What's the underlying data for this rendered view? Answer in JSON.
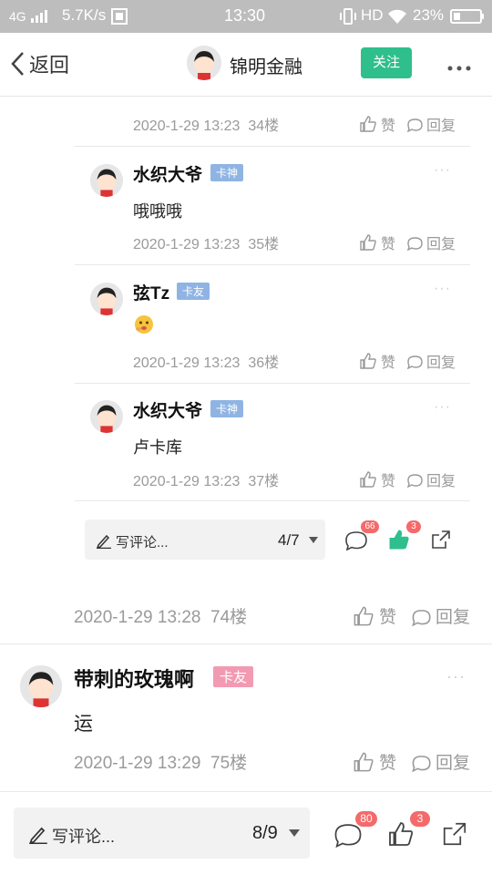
{
  "status_bar": {
    "network": "4G",
    "speed": "5.7K/s",
    "time": "13:30",
    "hd": "HD",
    "battery": "23%"
  },
  "nav": {
    "back_label": "返回",
    "title": "锦明金融",
    "follow_label": "关注",
    "more_icon": "more-icon"
  },
  "thread": {
    "top_meta": {
      "time": "2020-1-29 13:23",
      "floor": "34楼"
    },
    "replies": [
      {
        "name": "水织大爷",
        "badge": "卡神",
        "text": "哦哦哦",
        "time": "2020-1-29 13:23",
        "floor": "35楼"
      },
      {
        "name": "弦Tz",
        "badge": "卡友",
        "text": "",
        "time": "2020-1-29 13:23",
        "floor": "36楼"
      },
      {
        "name": "水织大爷",
        "badge": "卡神",
        "text": "卢卡库",
        "time": "2020-1-29 13:23",
        "floor": "37楼"
      }
    ],
    "like_label": "赞",
    "reply_label": "回复",
    "inner_bar": {
      "placeholder": "写评论...",
      "page": "4/7",
      "comment_count": "66",
      "like_count": "3"
    }
  },
  "post_74": {
    "time": "2020-1-29 13:28",
    "floor": "74楼",
    "like_label": "赞",
    "reply_label": "回复"
  },
  "post_75": {
    "name": "带刺的玫瑰啊",
    "badge": "卡友",
    "text": "运",
    "time": "2020-1-29 13:29",
    "floor": "75楼",
    "like_label": "赞",
    "reply_label": "回复"
  },
  "bottom_bar": {
    "placeholder": "写评论...",
    "page": "8/9",
    "comment_count": "80",
    "like_count": "3"
  },
  "colors": {
    "accent": "#2fbf8d",
    "badge_red": "#f46a6a",
    "badge_blue": "#8fb4e4",
    "badge_pink": "#f29ab2"
  }
}
